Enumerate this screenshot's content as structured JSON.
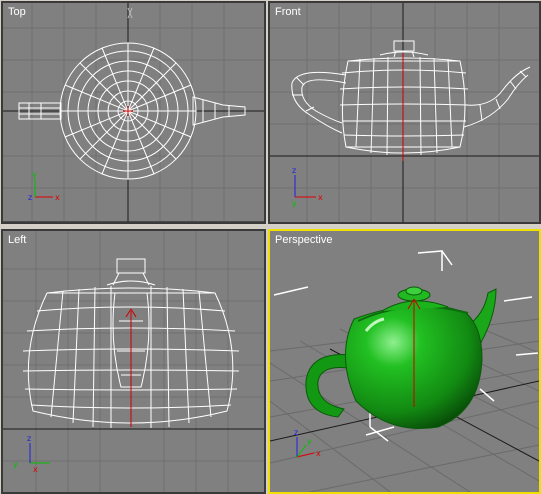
{
  "viewports": [
    {
      "id": "top",
      "label": "Top",
      "active": false,
      "axes": {
        "horizontal": "x",
        "vertical": "y",
        "origin": "z"
      }
    },
    {
      "id": "front",
      "label": "Front",
      "active": false,
      "axes": {
        "horizontal": "x",
        "vertical": "z",
        "origin": "y"
      }
    },
    {
      "id": "left",
      "label": "Left",
      "active": false,
      "axes": {
        "horizontal": "y",
        "vertical": "z",
        "origin": "x"
      }
    },
    {
      "id": "perspective",
      "label": "Perspective",
      "active": true,
      "axes": {
        "horizontal": "x",
        "vertical": "z",
        "origin": "y"
      }
    }
  ],
  "colors": {
    "viewport_bg": "#808080",
    "active_border": "#f0e000",
    "grid_line": "#6e6e6e",
    "home_grid": "#1a1a1a",
    "wireframe": "#ffffff",
    "pivot": "#cc0000",
    "teapot_shaded": "#19a819",
    "axis_x": "#e00000",
    "axis_y": "#00c000",
    "axis_z": "#2020e0"
  },
  "object": {
    "name_icon": "teapot-icon"
  }
}
